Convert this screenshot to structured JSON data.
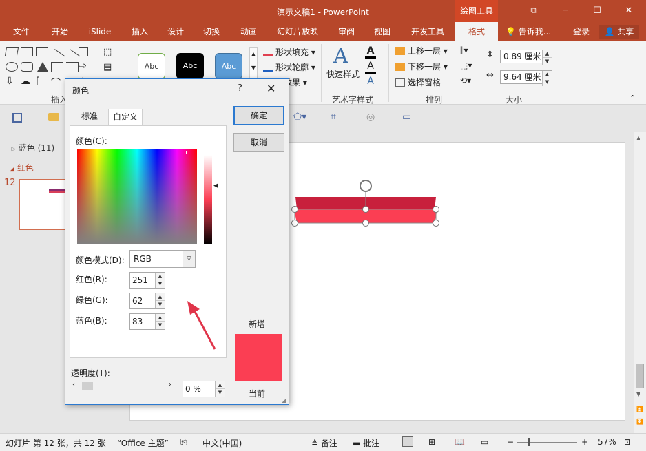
{
  "window": {
    "title": "演示文稿1 - PowerPoint",
    "context_tab": "绘图工具",
    "controls": [
      "⧉",
      "─",
      "☐",
      "✕"
    ]
  },
  "ribbon_tabs": [
    "文件",
    "开始",
    "iSlide",
    "插入",
    "设计",
    "切换",
    "动画",
    "幻灯片放映",
    "审阅",
    "视图",
    "开发工具",
    "格式"
  ],
  "tell_me": "告诉我...",
  "sign_in": "登录",
  "share": "共享",
  "ribbon": {
    "insert_shapes_label": "插入",
    "style_presets": [
      "Abc",
      "Abc",
      "Abc"
    ],
    "shape_fill": "形状填充",
    "shape_outline": "形状轮廓",
    "shape_effects": "效果",
    "quick_styles": "快速样式",
    "wordart_label": "艺术字样式",
    "bring_forward": "上移一层",
    "send_backward": "下移一层",
    "selection_pane": "选择窗格",
    "arrange_label": "排列",
    "height_value": "0.89 厘米",
    "width_value": "9.64 厘米",
    "size_label": "大小"
  },
  "thumbnails": {
    "section_collapsed": "蓝色 (11)",
    "section_expanded": "红色",
    "slide_number": "12"
  },
  "dialog": {
    "title": "颜色",
    "help": "?",
    "close": "✕",
    "tab_standard": "标准",
    "tab_custom": "自定义",
    "colors_label": "颜色(C):",
    "color_model_label": "颜色模式(D):",
    "color_model_value": "RGB",
    "red_label": "红色(R):",
    "red_value": "251",
    "green_label": "绿色(G):",
    "green_value": "62",
    "blue_label": "蓝色(B):",
    "blue_value": "83",
    "transparency_label": "透明度(T):",
    "transparency_value": "0 %",
    "ok": "确定",
    "cancel": "取消",
    "new_label": "新增",
    "current_label": "当前",
    "new_color": "#fb3e53",
    "current_color": "#fb3e53"
  },
  "statusbar": {
    "slide_info": "幻灯片 第 12 张，共 12 张",
    "theme": "“Office 主题”",
    "language": "中文(中国)",
    "notes": "备注",
    "comments": "批注",
    "zoom": "57%",
    "zoom_minus": "−",
    "zoom_plus": "+"
  },
  "colors": {
    "brand": "#b7472a",
    "brand_active": "#d24726",
    "shape_top": "#c8203c",
    "shape_bottom": "#fb3e53"
  }
}
